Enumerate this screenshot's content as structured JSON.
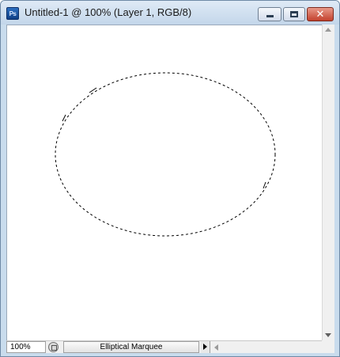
{
  "window": {
    "title": "Untitled-1 @ 100% (Layer 1, RGB/8)",
    "app_icon_text": "Ps",
    "close_glyph": "✕",
    "icons": [
      "photoshop-document-icon",
      "minimize-icon",
      "maximize-icon",
      "close-icon"
    ]
  },
  "statusbar": {
    "zoom": "100%",
    "tool": "Elliptical Marquee"
  },
  "colors": {
    "titlebar": "#c9dced",
    "close_button": "#c3412d",
    "canvas": "#ffffff",
    "selection_marquee": "#000000"
  }
}
